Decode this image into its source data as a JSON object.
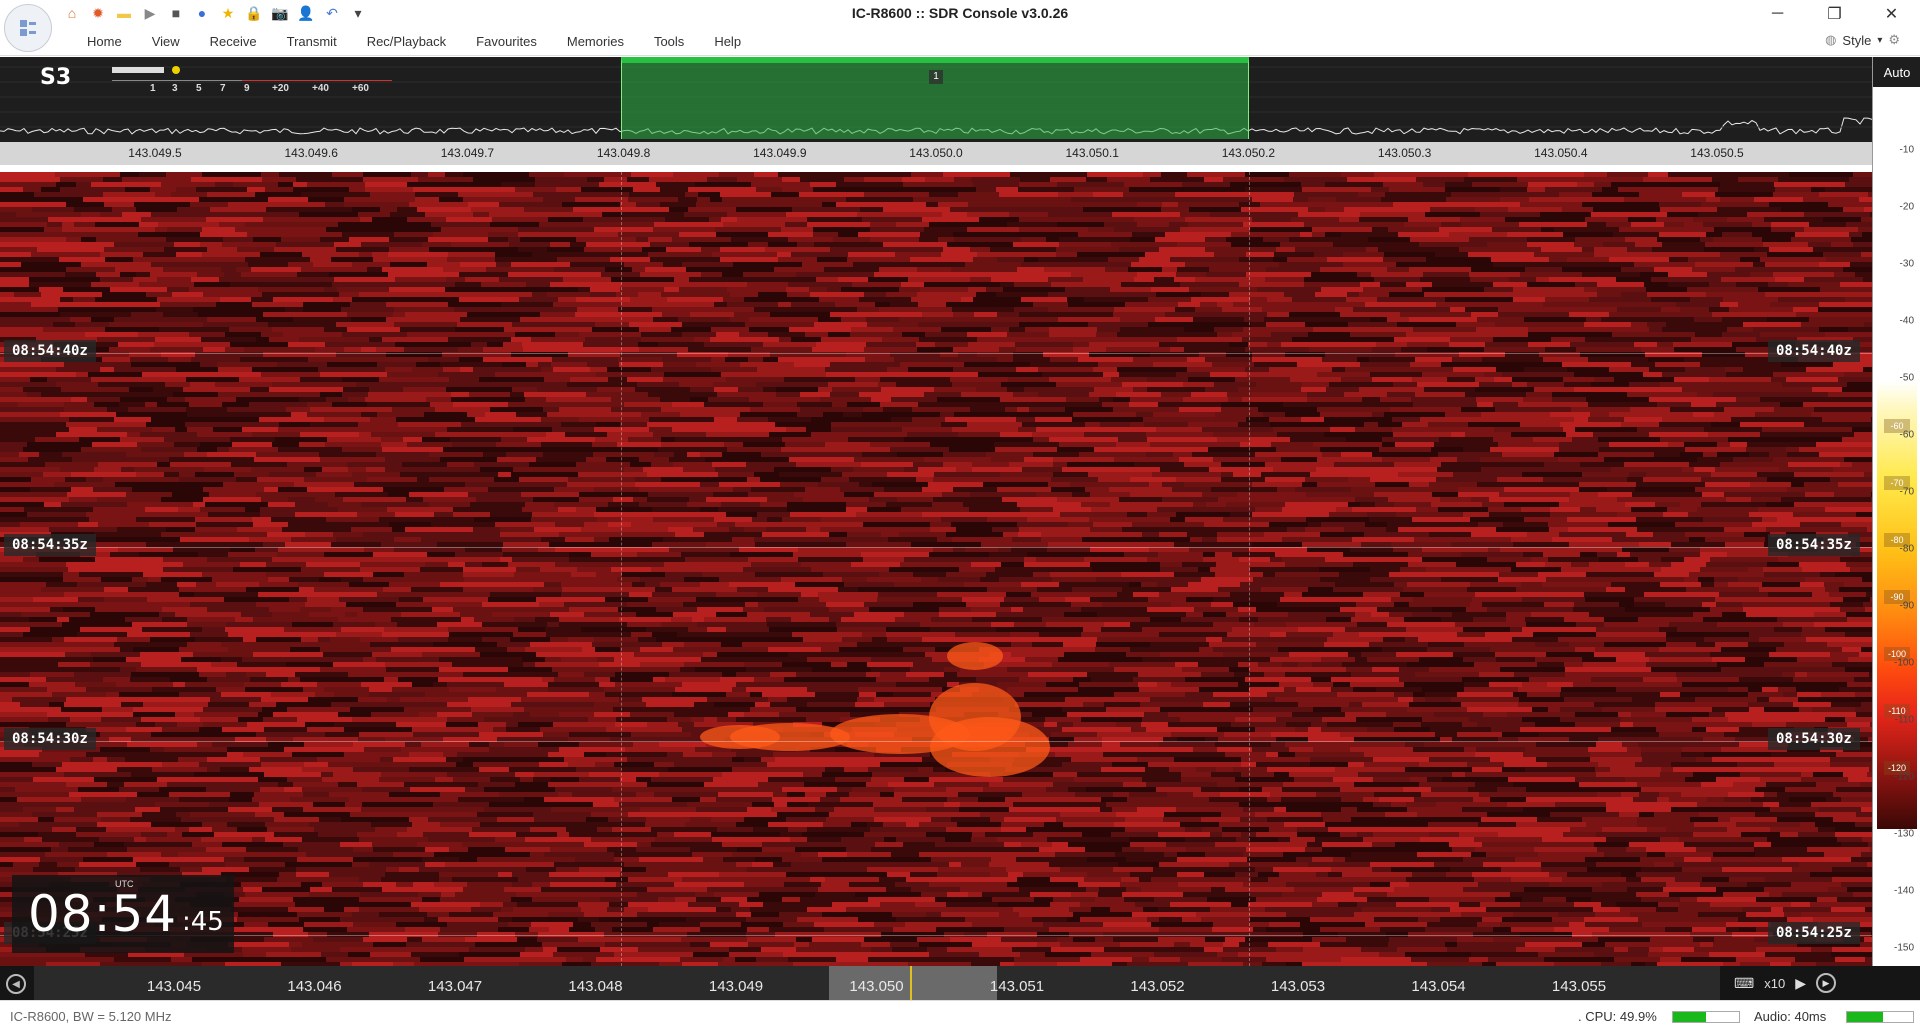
{
  "window": {
    "title": "IC-R8600 :: SDR Console v3.0.26",
    "minimize": "─",
    "restore": "❐",
    "close": "✕"
  },
  "quick_access": [
    {
      "name": "home-icon",
      "glyph": "⌂",
      "color": "#e07030"
    },
    {
      "name": "radio-icon",
      "glyph": "✹",
      "color": "#e05a2a"
    },
    {
      "name": "folder-icon",
      "glyph": "▬",
      "color": "#f2c84b"
    },
    {
      "name": "play-icon",
      "glyph": "▶",
      "color": "#888888"
    },
    {
      "name": "stop-icon",
      "glyph": "■",
      "color": "#555555"
    },
    {
      "name": "record-icon",
      "glyph": "●",
      "color": "#3b6fd8"
    },
    {
      "name": "favourite-icon",
      "glyph": "★",
      "color": "#f0b400"
    },
    {
      "name": "lock-icon",
      "glyph": "🔒",
      "color": "#d4a017"
    },
    {
      "name": "camera-icon",
      "glyph": "📷",
      "color": "#333333"
    },
    {
      "name": "user-icon",
      "glyph": "👤",
      "color": "#2a6fd0"
    },
    {
      "name": "undo-icon",
      "glyph": "↶",
      "color": "#4a7bd6"
    },
    {
      "name": "customize-icon",
      "glyph": "▾",
      "color": "#444444"
    }
  ],
  "menu": [
    "Home",
    "View",
    "Receive",
    "Transmit",
    "Rec/Playback",
    "Favourites",
    "Memories",
    "Tools",
    "Help"
  ],
  "style_menu": "Style",
  "spectrum": {
    "smeter": "S3",
    "smeter_ticks": [
      "1",
      "3",
      "5",
      "7",
      "9",
      "+20",
      "+40",
      "+60"
    ],
    "vfo_marker": "1",
    "freq_labels": [
      "143.049.5",
      "143.049.6",
      "143.049.7",
      "143.049.8",
      "143.049.9",
      "143.050.0",
      "143.050.1",
      "143.050.2",
      "143.050.3",
      "143.050.4",
      "143.050.5"
    ]
  },
  "level_scale": {
    "auto_label": "Auto",
    "ticks": [
      "-10",
      "-20",
      "-30",
      "-40",
      "-50",
      "-60",
      "-70",
      "-80",
      "-90",
      "-100",
      "-110",
      "-120",
      "-130",
      "-140",
      "-150"
    ],
    "colorbar_labels": [
      "-60",
      "-70",
      "-80",
      "-90",
      "-100",
      "-110",
      "-120"
    ]
  },
  "waterfall": {
    "time_tags": [
      "08:54:40z",
      "08:54:35z",
      "08:54:30z",
      "08:54:25z"
    ]
  },
  "clock": {
    "zone": "UTC",
    "hm": "08:54",
    "s": ":45"
  },
  "freqbar": {
    "labels": [
      "143.045",
      "143.046",
      "143.047",
      "143.048",
      "143.049",
      "143.050",
      "143.051",
      "143.052",
      "143.053",
      "143.054",
      "143.055"
    ],
    "zoom": "x10",
    "scroll_left": "◀",
    "scroll_right": "▶",
    "keyboard_icon": "⌨"
  },
  "status": {
    "left": "IC-R8600, BW = 5.120 MHz",
    "cpu_text": ". CPU: 49.9%",
    "cpu_percent": 49.9,
    "audio_text": "Audio: 40ms",
    "audio_fill": 0.55
  },
  "colors": {
    "filter_green": "#27c040",
    "waterfall_base": "#6a1414",
    "signal": "#ff5a18"
  }
}
